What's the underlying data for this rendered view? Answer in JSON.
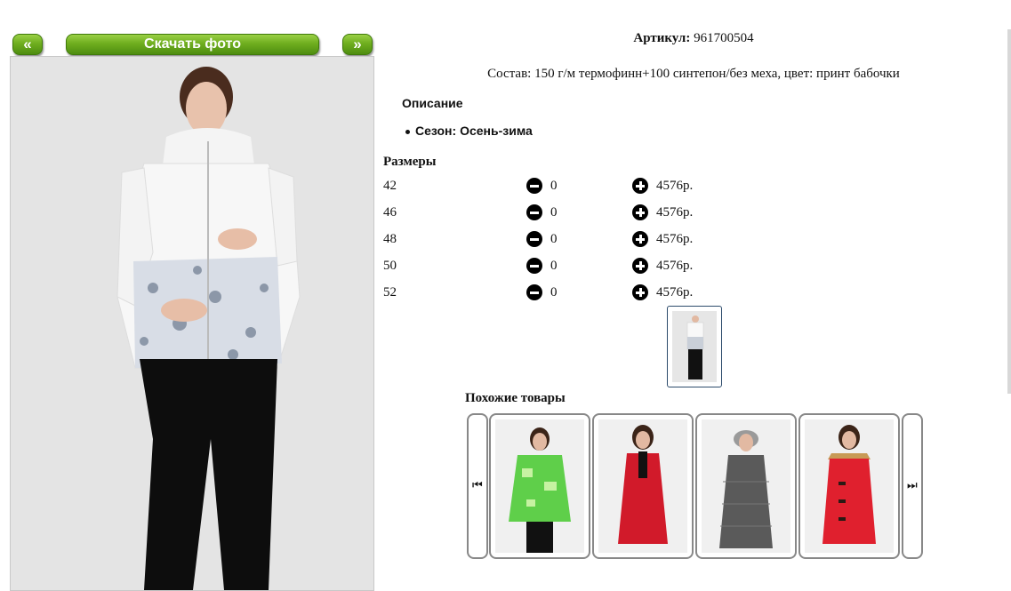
{
  "gallery": {
    "prev_label": "«",
    "download_label": "Скачать фото",
    "next_label": "»"
  },
  "product": {
    "article_label": "Артикул:",
    "article_value": "961700504",
    "composition": "Состав: 150 г/м термофинн+100 синтепон/без меха, цвет: принт бабочки",
    "description_title": "Описание",
    "season": "Сезон: Осень-зима",
    "sizes_title": "Размеры",
    "sizes": [
      {
        "size": "42",
        "qty": "0",
        "price": "4576р."
      },
      {
        "size": "46",
        "qty": "0",
        "price": "4576р."
      },
      {
        "size": "48",
        "qty": "0",
        "price": "4576р."
      },
      {
        "size": "50",
        "qty": "0",
        "price": "4576р."
      },
      {
        "size": "52",
        "qty": "0",
        "price": "4576р."
      }
    ]
  },
  "similar": {
    "title": "Похожие товары",
    "prev_icon": "skip-back-icon",
    "next_icon": "skip-forward-icon",
    "items": [
      {
        "name": "green-print-jacket",
        "color": "#5fcf4a"
      },
      {
        "name": "red-coat",
        "color": "#d11a2a"
      },
      {
        "name": "gray-fur-coat",
        "color": "#5a5a5a"
      },
      {
        "name": "red-fur-coat",
        "color": "#e0202e"
      }
    ]
  },
  "colors": {
    "button_green": "#6fae1f",
    "photo_bg": "#e4e4e4"
  }
}
